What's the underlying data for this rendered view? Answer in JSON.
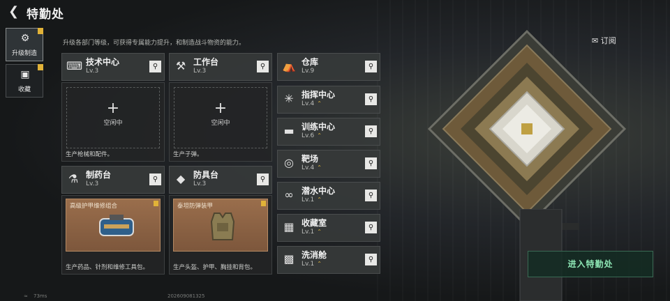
{
  "header": {
    "title": "特勤处",
    "back_icon": "back-arrow-icon"
  },
  "subtitle": "升级各部门等级，可获得专属能力提升，和制造战斗物资的能力。",
  "leftnav": [
    {
      "label": "升级制造",
      "icon": "upgrade-icon",
      "active": true
    },
    {
      "label": "收藏",
      "icon": "collection-icon",
      "active": false
    }
  ],
  "subscribe": {
    "label": "订阅",
    "icon": "subscribe-icon"
  },
  "workshops": [
    {
      "name": "技术中心",
      "level": "Lv.3",
      "icon": "tech-center-icon",
      "idle": "空闲中",
      "desc": "生产枪械和配件。"
    },
    {
      "name": "工作台",
      "level": "Lv.3",
      "icon": "workbench-icon",
      "idle": "空闲中",
      "desc": "生产子弹。"
    },
    {
      "name": "制药台",
      "level": "Lv.3",
      "icon": "pharmacy-icon",
      "craft": "高级护甲维修组合",
      "desc": "生产药品、针剂和维修工具包。"
    },
    {
      "name": "防具台",
      "level": "Lv.3",
      "icon": "armor-bench-icon",
      "craft": "泰坦防弹装甲",
      "desc": "生产头盔、护甲、胸挂和背包。"
    }
  ],
  "facilities": [
    {
      "name": "仓库",
      "level": "Lv.9",
      "icon": "warehouse-icon",
      "upgradable": false
    },
    {
      "name": "指挥中心",
      "level": "Lv.4",
      "icon": "command-center-icon",
      "upgradable": true
    },
    {
      "name": "训练中心",
      "level": "Lv.6",
      "icon": "training-center-icon",
      "upgradable": true
    },
    {
      "name": "靶场",
      "level": "Lv.4",
      "icon": "range-icon",
      "upgradable": true
    },
    {
      "name": "潜水中心",
      "level": "Lv.1",
      "icon": "diving-center-icon",
      "upgradable": true
    },
    {
      "name": "收藏室",
      "level": "Lv.1",
      "icon": "collection-room-icon",
      "upgradable": true
    },
    {
      "name": "洗消舱",
      "level": "Lv.1",
      "icon": "decon-chamber-icon",
      "upgradable": true
    }
  ],
  "enter_button": "进入特勤处",
  "footer": {
    "ping": "73ms",
    "uid": "202609081325"
  },
  "colors": {
    "accent_gold": "#e1b238",
    "enter_green": "#8de6b4"
  }
}
